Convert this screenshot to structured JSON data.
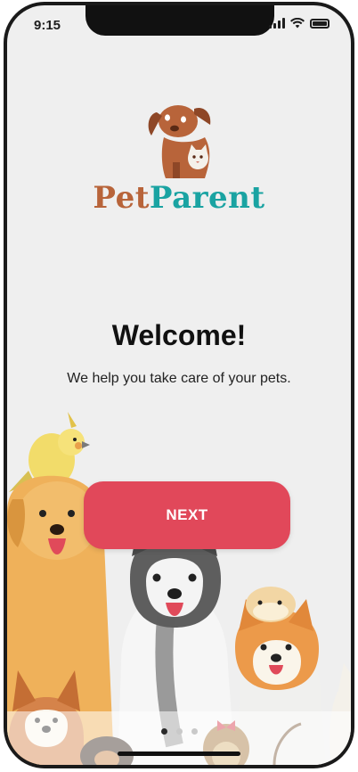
{
  "status_bar": {
    "time": "9:15",
    "icons": [
      "signal-icon",
      "wifi-icon",
      "battery-icon"
    ]
  },
  "brand": {
    "name_part1": "Pet",
    "name_part2": "Parent",
    "color_part1": "#b8643a",
    "color_part2": "#1aa3a2"
  },
  "onboarding": {
    "title": "Welcome!",
    "subtitle": "We help you take care of your pets.",
    "next_label": "NEXT",
    "button_color": "#e1485a",
    "pages_total": 3,
    "current_page": 1
  }
}
